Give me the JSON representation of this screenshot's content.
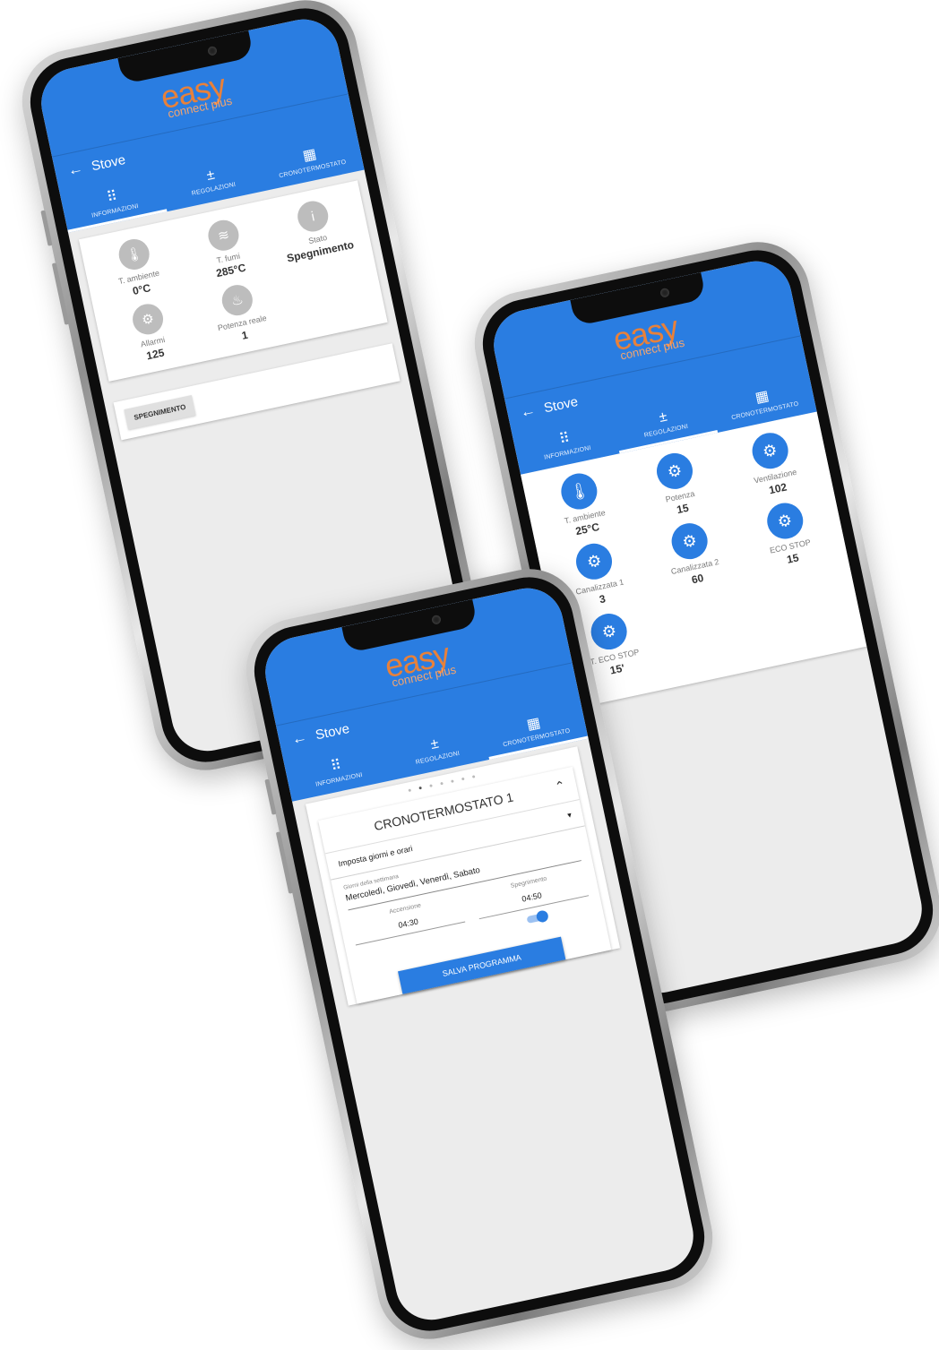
{
  "app": {
    "logo_main": "easy",
    "logo_sub": "connect plus",
    "title": "Stove",
    "back_icon": "arrow-left-icon",
    "tabs": [
      {
        "label": "INFORMAZIONI",
        "icon": "grid-icon"
      },
      {
        "label": "REGOLAZIONI",
        "icon": "plus-minus-icon"
      },
      {
        "label": "CRONOTERMOSTATO",
        "icon": "calendar-icon"
      }
    ],
    "accent_color": "#2a7de1",
    "logo_color": "#e8813a"
  },
  "phone1": {
    "info": [
      {
        "label": "T. ambiente",
        "value": "0°C",
        "icon": "thermometer-icon"
      },
      {
        "label": "T. fumi",
        "value": "285°C",
        "icon": "smoke-icon"
      },
      {
        "label": "Stato",
        "value": "Spegnimento",
        "icon": "info-icon"
      },
      {
        "label": "Allarmi",
        "value": "125",
        "icon": "gears-icon"
      },
      {
        "label": "Potenza reale",
        "value": "1",
        "icon": "flame-icon"
      }
    ],
    "action_button": "SPEGNIMENTO"
  },
  "phone2": {
    "settings": [
      {
        "label": "T. ambiente",
        "value": "25°C",
        "icon": "thermometer-icon"
      },
      {
        "label": "Potenza",
        "value": "15",
        "icon": "gears-icon"
      },
      {
        "label": "Ventilazione",
        "value": "102",
        "icon": "gears-icon"
      },
      {
        "label": "Canalizzata 1",
        "value": "3",
        "icon": "gears-icon"
      },
      {
        "label": "Canalizzata 2",
        "value": "60",
        "icon": "gears-icon"
      },
      {
        "label": "ECO STOP",
        "value": "15",
        "icon": "gears-icon"
      },
      {
        "label": "T. ECO STOP",
        "value": "15'",
        "icon": "gears-icon"
      }
    ]
  },
  "phone3": {
    "pager_total": 7,
    "pager_active": 2,
    "crono_title": "CRONOTERMOSTATO 1",
    "section_label": "Imposta giorni e orari",
    "days_field_label": "Giorni della settimana",
    "days_field_value": "Mercoledì, Giovedì, Venerdì, Sabato",
    "on_label": "Accensione",
    "on_value": "04:30",
    "off_label": "Spegnimento",
    "off_value": "04:50",
    "toggle_on": true,
    "save_button": "SALVA PROGRAMMA"
  }
}
